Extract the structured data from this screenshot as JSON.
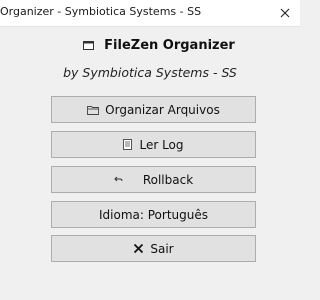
{
  "window": {
    "title": "Organizer - Symbiotica Systems - SS"
  },
  "header": {
    "title": "FileZen Organizer",
    "subtitle": "by Symbiotica Systems - SS"
  },
  "buttons": {
    "organize": {
      "label": "Organizar Arquivos",
      "icon": "folder-icon"
    },
    "log": {
      "label": "Ler Log",
      "icon": "document-icon"
    },
    "rollback": {
      "label": "Rollback",
      "icon": "undo-arrow-icon"
    },
    "language": {
      "label": "Idioma: Português"
    },
    "exit": {
      "label": "Sair",
      "icon": "x-icon"
    }
  }
}
